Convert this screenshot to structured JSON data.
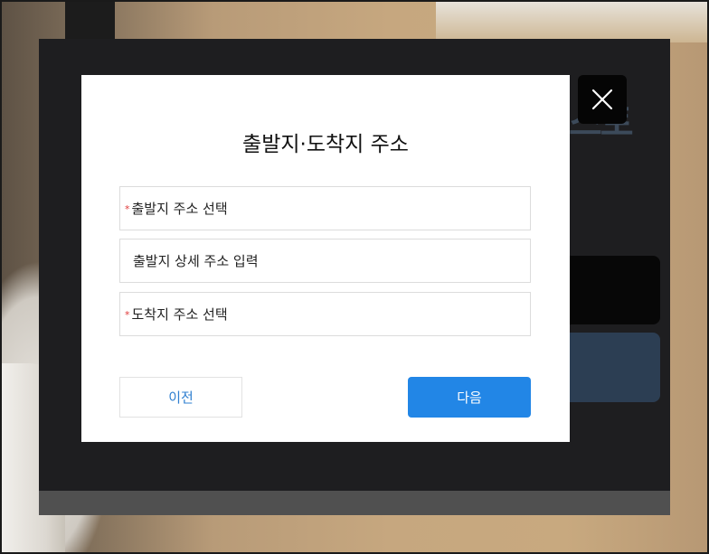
{
  "background": {
    "page_title_partial": "스토"
  },
  "modal": {
    "title": "출발지·도착지 주소",
    "fields": [
      {
        "required_mark": "*",
        "label": "출발지 주소 선택"
      },
      {
        "required_mark": "",
        "label": "출발지 상세 주소 입력"
      },
      {
        "required_mark": "*",
        "label": "도착지 주소 선택"
      }
    ],
    "prev_label": "이전",
    "next_label": "다음"
  },
  "colors": {
    "accent": "#2286e6",
    "required": "#e03a3a",
    "backdrop": "#1e1e20"
  },
  "icons": {
    "close": "close-icon"
  }
}
